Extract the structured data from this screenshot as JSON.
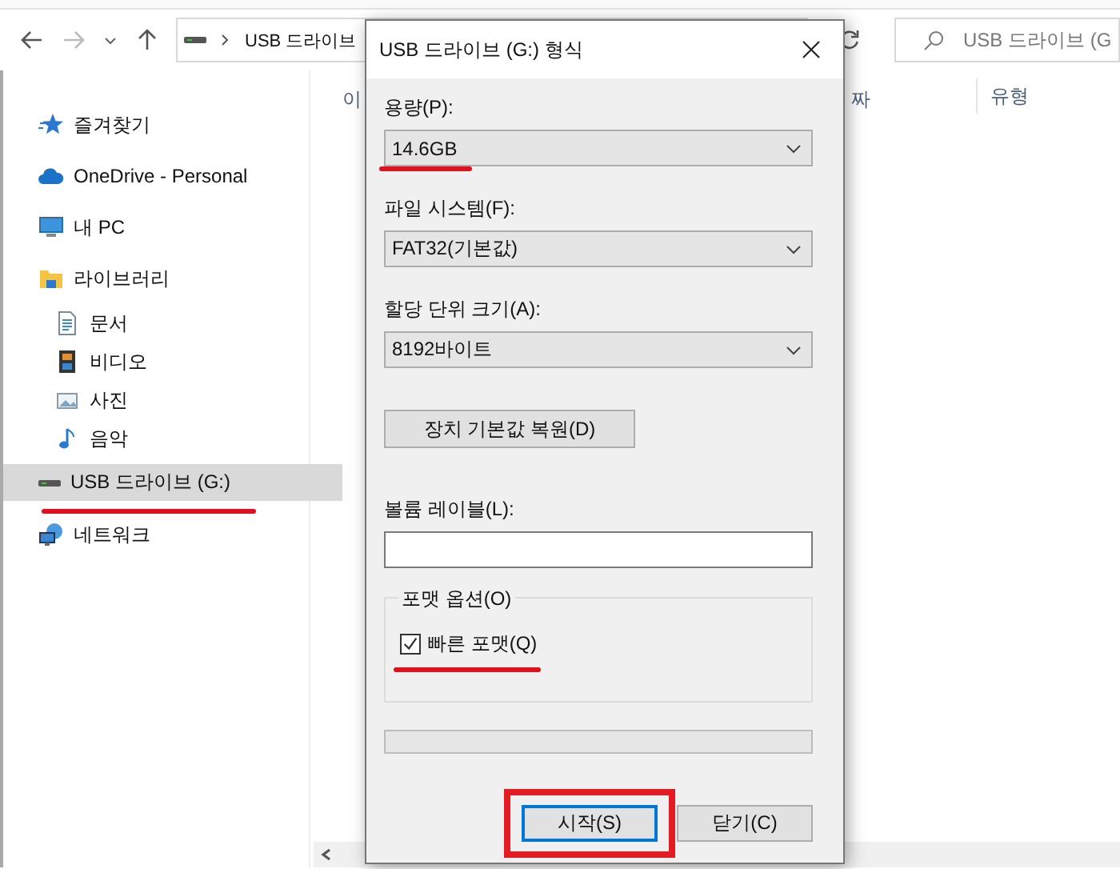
{
  "explorer": {
    "address": "USB 드라이브",
    "search_placeholder": "USB 드라이브 (G",
    "sidebar": {
      "items": [
        {
          "label": "즐겨찾기",
          "kind": "star",
          "selected": false,
          "annotated": false
        },
        {
          "label": "OneDrive - Personal",
          "kind": "cloud",
          "selected": false,
          "annotated": false
        },
        {
          "label": "내 PC",
          "kind": "pc",
          "selected": false,
          "annotated": false
        },
        {
          "label": "라이브러리",
          "kind": "library",
          "selected": false,
          "annotated": false,
          "children": [
            {
              "label": "문서",
              "kind": "document",
              "selected": false,
              "annotated": false
            },
            {
              "label": "비디오",
              "kind": "video",
              "selected": false,
              "annotated": false
            },
            {
              "label": "사진",
              "kind": "photo",
              "selected": false,
              "annotated": false
            },
            {
              "label": "음악",
              "kind": "music",
              "selected": false,
              "annotated": false
            }
          ]
        },
        {
          "label": "USB 드라이브 (G:)",
          "kind": "drive",
          "selected": true,
          "annotated": true
        },
        {
          "label": "네트워크",
          "kind": "network",
          "selected": false,
          "annotated": false
        }
      ]
    },
    "columns": [
      "이",
      "짜",
      "유형"
    ]
  },
  "dialog": {
    "title": "USB 드라이브 (G:) 형식",
    "fields": [
      {
        "label": "용량(P):",
        "value": "14.6GB",
        "annotated": true
      },
      {
        "label": "파일 시스템(F):",
        "value": "FAT32(기본값)",
        "annotated": false
      },
      {
        "label": "할당 단위 크기(A):",
        "value": "8192바이트",
        "annotated": false
      }
    ],
    "restore_button": "장치 기본값 복원(D)",
    "volume_label": {
      "label": "볼륨 레이블(L):"
    },
    "options": {
      "legend": "포맷 옵션(O)",
      "quick_format": {
        "label": "빠른 포맷(Q)",
        "checked": true,
        "annotated": true
      }
    },
    "progress": {
      "level": 0
    },
    "buttons": [
      {
        "label": "시작(S)",
        "default": true,
        "annotated": true
      },
      {
        "label": "닫기(C)",
        "default": false,
        "annotated": false
      }
    ]
  }
}
